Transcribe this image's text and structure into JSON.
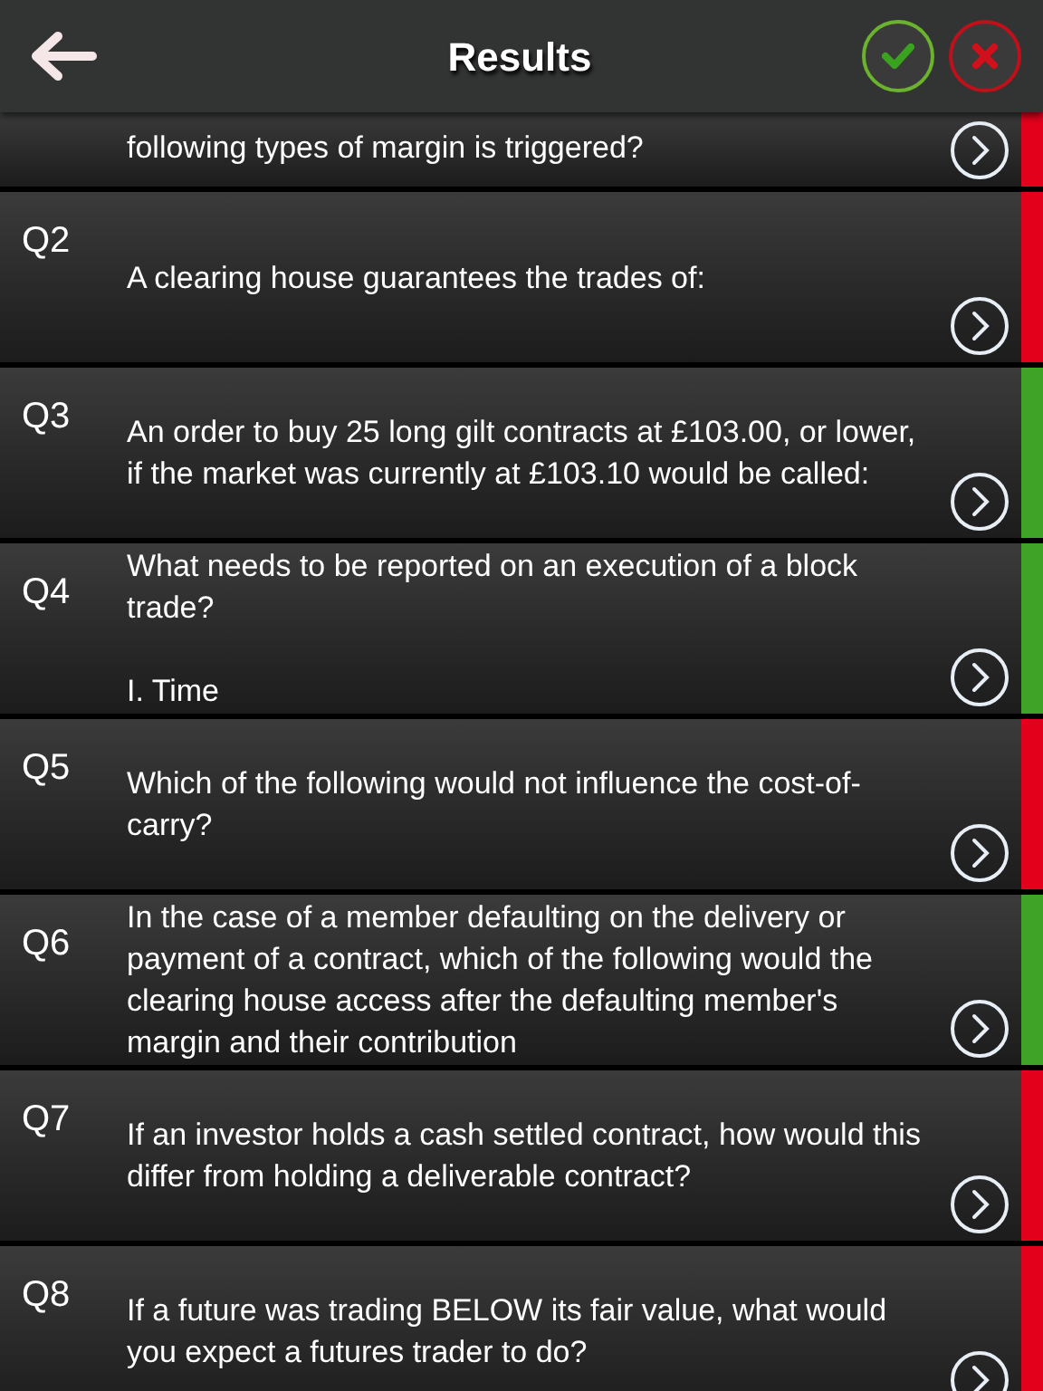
{
  "header": {
    "title": "Results"
  },
  "questions": [
    {
      "paragraphs": [
        "following types of margin is triggered?"
      ],
      "correct": false,
      "partial": true
    },
    {
      "number": "Q2",
      "paragraphs": [
        "A clearing house guarantees the trades of:"
      ],
      "correct": false
    },
    {
      "number": "Q3",
      "paragraphs": [
        "An order to buy 25 long gilt contracts at £103.00, or lower, if the market was currently at £103.10 would be called:"
      ],
      "correct": true
    },
    {
      "number": "Q4",
      "paragraphs": [
        "What needs to be reported on an execution of a block trade?",
        "I. Time"
      ],
      "correct": true
    },
    {
      "number": "Q5",
      "paragraphs": [
        "Which of the following would not influence the cost-of-carry?"
      ],
      "correct": false
    },
    {
      "number": "Q6",
      "paragraphs": [
        "In the case of a member defaulting on the delivery or payment of a contract, which of the following would the clearing house access after the defaulting member's margin and their contribution"
      ],
      "correct": true
    },
    {
      "number": "Q7",
      "paragraphs": [
        "If an investor holds a cash settled contract, how would this differ from holding a deliverable contract?"
      ],
      "correct": false
    },
    {
      "number": "Q8",
      "paragraphs": [
        "If a future was trading BELOW its fair value, what would you expect a futures trader to do?"
      ],
      "correct": false
    }
  ]
}
